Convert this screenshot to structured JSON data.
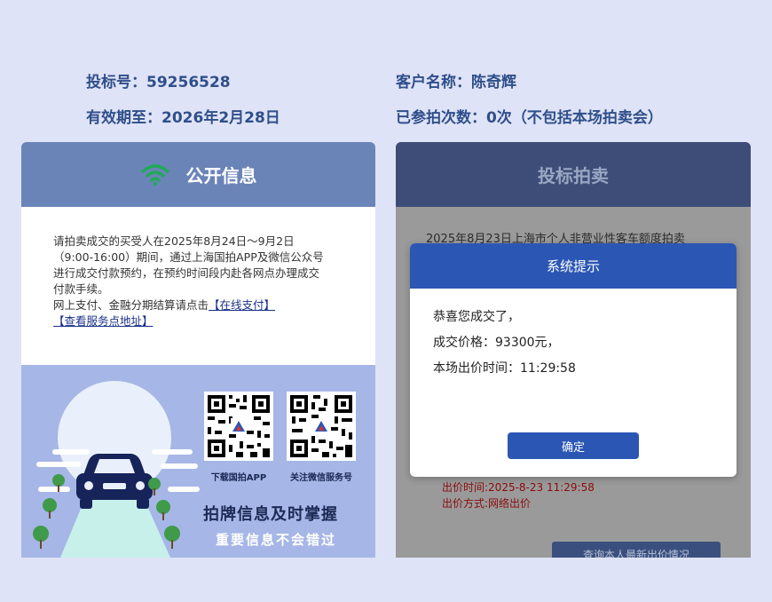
{
  "header": {
    "bid_number": "投标号：59256528",
    "valid_until": "有效期至：2026年2月28日",
    "customer_name": "客户名称：陈奇辉",
    "participation_count": "已参拍次数：0次（不包括本场拍卖会）"
  },
  "left_panel": {
    "title": "公开信息",
    "notice_lines": [
      "请拍卖成交的买受人在2025年8月24日～9月2日",
      "（9:00-16:00）期间，通过上海国拍APP及微信公众号",
      "进行成交付款预约，在预约时间段内赴各网点办理成交",
      "付款手续。",
      "网上支付、金融分期结算请点击"
    ],
    "online_pay_link": "【在线支付】",
    "service_points_link": "【查看服务点地址】",
    "qr_download_caption": "下载国拍APP",
    "qr_follow_caption": "关注微信服务号",
    "slogan_main": "拍牌信息及时掌握",
    "slogan_sub": "重要信息不会错过"
  },
  "right_panel": {
    "title": "投标拍卖",
    "auction_line": "2025年8月23日上海市个人非营业性客车额度拍卖",
    "bid_time_bg": "出价时间:2025-8-23 11:29:58",
    "bid_method_bg": "出价方式:网络出价",
    "query_button": "查询本人最新出价情况"
  },
  "dialog": {
    "title": "系统提示",
    "line1": "恭喜您成交了，",
    "line2": "成交价格：93300元，",
    "line3": "本场出价时间：11:29:58",
    "ok_button": "确定"
  },
  "colors": {
    "left_header": "#6b84b8",
    "right_header": "#3d4d78",
    "dialog_accent": "#2c56b4",
    "header_text": "#2f4f8a",
    "wifi_icon": "#22a85a"
  }
}
